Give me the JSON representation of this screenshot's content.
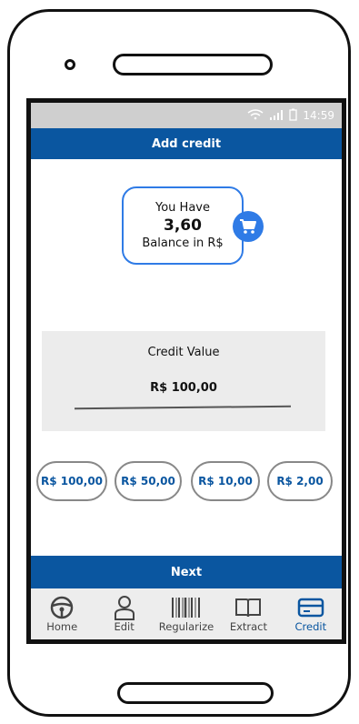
{
  "status_bar": {
    "time": "14:59"
  },
  "header": {
    "title": "Add credit"
  },
  "balance": {
    "line1": "You Have",
    "value": "3,60",
    "line3": "Balance in R$"
  },
  "credit_panel": {
    "label": "Credit Value",
    "value": "R$ 100,00"
  },
  "amounts": [
    "R$ 100,00",
    "R$ 50,00",
    "R$ 10,00",
    "R$ 2,00"
  ],
  "next_label": "Next",
  "tabs": [
    {
      "label": "Home",
      "icon": "steering-wheel-icon"
    },
    {
      "label": "Edit",
      "icon": "user-icon"
    },
    {
      "label": "Regularize",
      "icon": "barcode-icon"
    },
    {
      "label": "Extract",
      "icon": "book-icon"
    },
    {
      "label": "Credit",
      "icon": "credit-card-icon"
    }
  ],
  "colors": {
    "primary": "#0a56a0",
    "accent": "#2f7be6",
    "status_bar": "#cfcfcf",
    "panel": "#ececec"
  }
}
